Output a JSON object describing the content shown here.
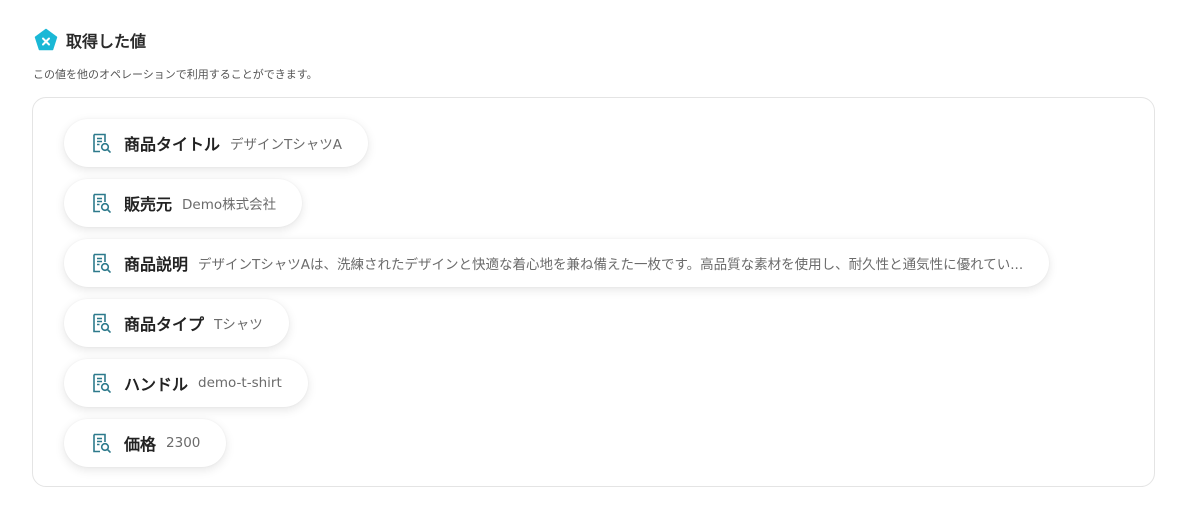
{
  "header": {
    "title": "取得した値",
    "description": "この値を他のオペレーションで利用することができます。",
    "brand_icon": "yoom-pentagon-icon",
    "brand_color": "#1ab8d6"
  },
  "fields": [
    {
      "label": "商品タイトル",
      "value": "デザインTシャツA",
      "icon": "document-search-icon"
    },
    {
      "label": "販売元",
      "value": "Demo株式会社",
      "icon": "document-search-icon"
    },
    {
      "label": "商品説明",
      "value": "デザインTシャツAは、洗練されたデザインと快適な着心地を兼ね備えた一枚です。高品質な素材を使用し、耐久性と通気性に優れてい...",
      "icon": "document-search-icon"
    },
    {
      "label": "商品タイプ",
      "value": "Tシャツ",
      "icon": "document-search-icon"
    },
    {
      "label": "ハンドル",
      "value": "demo-t-shirt",
      "icon": "document-search-icon"
    },
    {
      "label": "価格",
      "value": "2300",
      "icon": "document-search-icon"
    }
  ],
  "icon_color": "#2d7a8c"
}
